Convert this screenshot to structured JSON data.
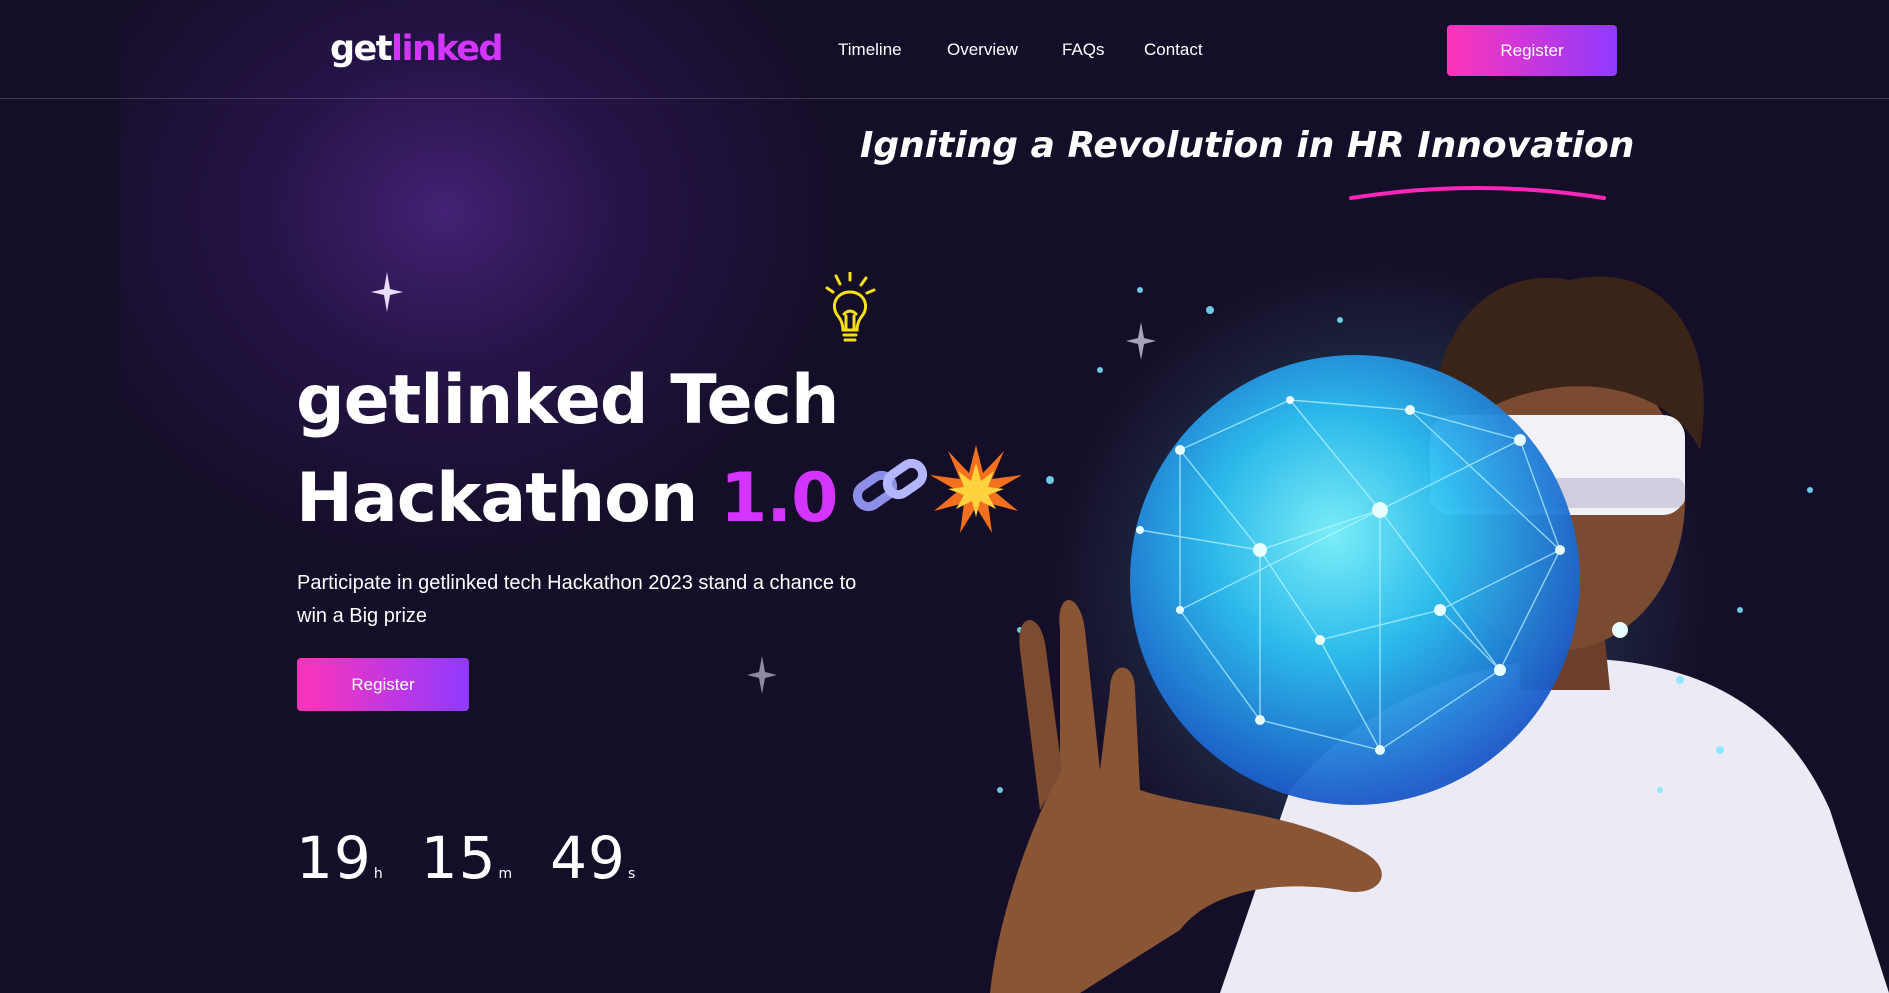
{
  "brand": {
    "logo_part1": "get",
    "logo_part2": "linked"
  },
  "nav": {
    "items": [
      {
        "label": "Timeline"
      },
      {
        "label": "Overview"
      },
      {
        "label": "FAQs"
      },
      {
        "label": "Contact"
      }
    ],
    "register_label": "Register"
  },
  "hero": {
    "tagline": "Igniting a Revolution in HR Innovation",
    "title_line1": "getlinked Tech",
    "title_line2_part1": "Hackathon",
    "title_line2_accent": "1.0",
    "description": "Participate in getlinked tech Hackathon 2023 stand a chance to win a Big prize",
    "register_label": "Register",
    "countdown": [
      {
        "value": "19",
        "unit": "h"
      },
      {
        "value": "15",
        "unit": "m"
      },
      {
        "value": "49",
        "unit": "s"
      }
    ]
  },
  "colors": {
    "background": "#150e28",
    "accent": "#d434fe",
    "button_gradient_start": "#fe34b9",
    "button_gradient_end": "#903aff",
    "underline": "#ff26b9"
  },
  "icons": [
    "star-icon",
    "lightbulb-icon",
    "chain-icon",
    "sparkle-burst-icon"
  ]
}
